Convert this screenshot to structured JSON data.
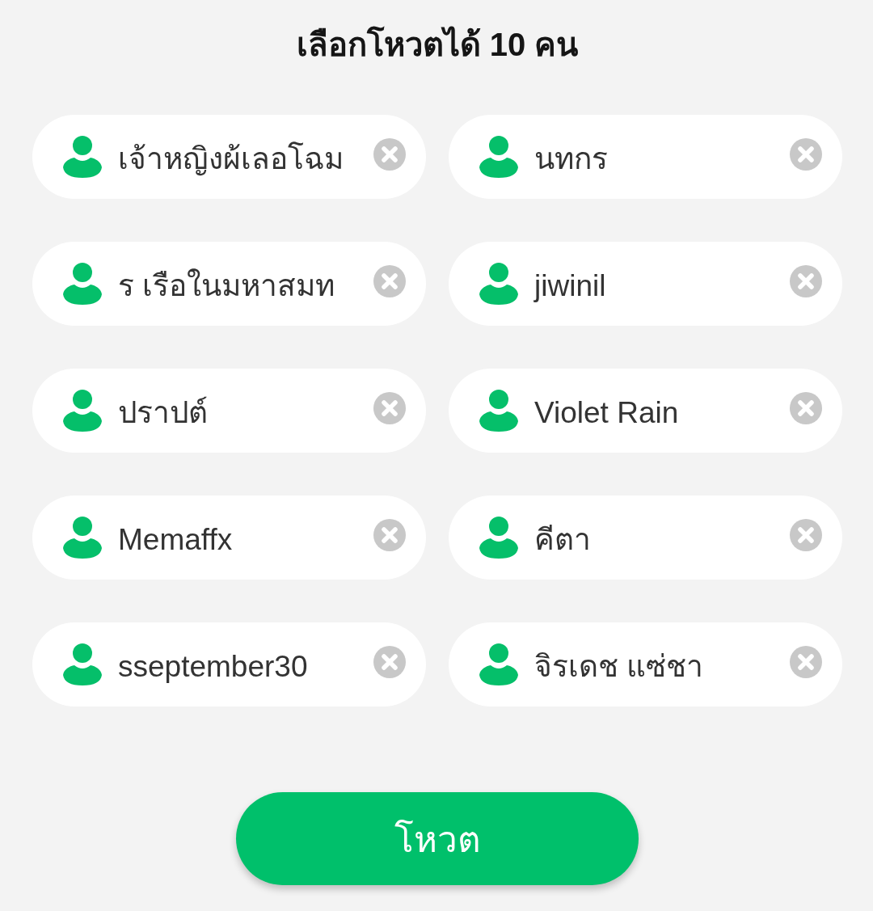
{
  "title": "เลือกโหวตได้ 10 คน",
  "candidates": [
    {
      "name": "เจ้าหญิงผ้เลอโฉม"
    },
    {
      "name": "นทกร"
    },
    {
      "name": "ร เรือในมหาสมท"
    },
    {
      "name": "jiwinil"
    },
    {
      "name": "ปราปต์"
    },
    {
      "name": "Violet Rain"
    },
    {
      "name": "Memaffx"
    },
    {
      "name": "คีตา"
    },
    {
      "name": "sseptember30"
    },
    {
      "name": "จิรเดช แซ่ชา"
    }
  ],
  "vote_button": {
    "label": "โหวต"
  }
}
